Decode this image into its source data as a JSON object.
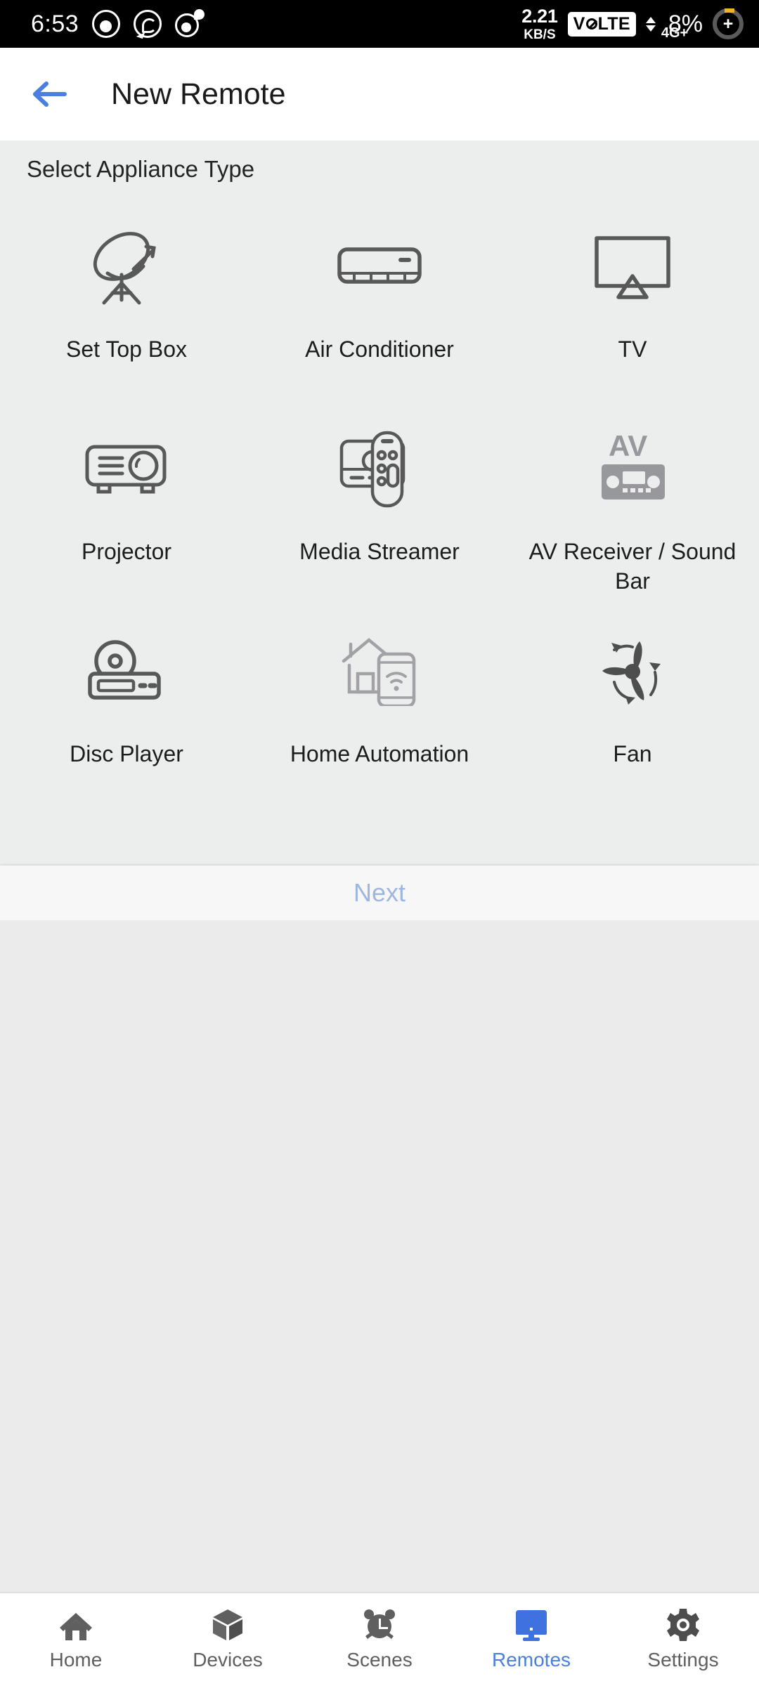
{
  "statusbar": {
    "clock": "6:53",
    "left_icons": [
      "camera-circle-icon",
      "whatsapp-icon",
      "location-circle-icon"
    ],
    "net_speed_value": "2.21",
    "net_speed_unit": "KB/S",
    "volte_label_a": "V",
    "volte_label_b": "LTE",
    "network_type": "4G+",
    "battery_percent": "8%",
    "battery_state": "charging"
  },
  "appbar": {
    "back_icon": "arrow-left-icon",
    "title": "New Remote",
    "accent": "#4a7fe0"
  },
  "content": {
    "section_label": "Select Appliance Type",
    "appliances": [
      {
        "label": "Set Top Box",
        "icon": "satellite-dish-icon"
      },
      {
        "label": "Air Conditioner",
        "icon": "air-conditioner-icon"
      },
      {
        "label": "TV",
        "icon": "television-icon"
      },
      {
        "label": "Projector",
        "icon": "projector-icon"
      },
      {
        "label": "Media Streamer",
        "icon": "media-streamer-icon"
      },
      {
        "label": "AV Receiver / Sound Bar",
        "icon": "av-receiver-icon"
      },
      {
        "label": "Disc Player",
        "icon": "disc-player-icon"
      },
      {
        "label": "Home Automation",
        "icon": "home-automation-icon"
      },
      {
        "label": "Fan",
        "icon": "fan-icon"
      }
    ]
  },
  "next_button": {
    "label": "Next",
    "enabled": false,
    "color": "#9fb6de"
  },
  "bottomnav": {
    "active_color": "#4a7fe0",
    "inactive_color": "#5f5f5f",
    "items": [
      {
        "label": "Home",
        "icon": "home-icon",
        "active": false
      },
      {
        "label": "Devices",
        "icon": "cube-icon",
        "active": false
      },
      {
        "label": "Scenes",
        "icon": "alarm-clock-icon",
        "active": false
      },
      {
        "label": "Remotes",
        "icon": "monitor-icon",
        "active": true
      },
      {
        "label": "Settings",
        "icon": "gear-icon",
        "active": false
      }
    ]
  }
}
